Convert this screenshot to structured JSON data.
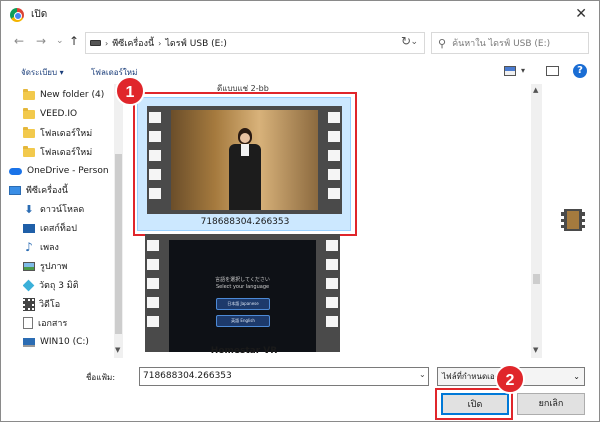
{
  "window": {
    "title": "เปิด",
    "close": "✕"
  },
  "nav": {
    "back": "←",
    "forward": "→",
    "recent": "⌄",
    "up": "↑",
    "breadcrumb": [
      "พีซีเครื่องนี้",
      "ไดรฟ์ USB (E:)"
    ],
    "refresh": "↻",
    "search_placeholder": "ค้นหาใน ไดรฟ์ USB (E:)"
  },
  "toolbar": {
    "organize": "จัดระเบียบ ▾",
    "new_folder": "โฟลเดอร์ใหม่",
    "help": "?"
  },
  "sidebar": {
    "items": [
      {
        "label": "New folder (4)",
        "icon": "folder-icon"
      },
      {
        "label": "VEED.IO",
        "icon": "folder-icon"
      },
      {
        "label": "โฟลเดอร์ใหม่",
        "icon": "folder-icon"
      },
      {
        "label": "โฟลเดอร์ใหม่",
        "icon": "folder-icon"
      },
      {
        "label": "OneDrive - Person",
        "icon": "onedrive-icon"
      },
      {
        "label": "พีซีเครื่องนี้",
        "icon": "this-pc-icon"
      },
      {
        "label": "ดาวน์โหลด",
        "icon": "downloads-icon"
      },
      {
        "label": "เดสก์ท็อป",
        "icon": "desktop-icon"
      },
      {
        "label": "เพลง",
        "icon": "music-icon"
      },
      {
        "label": "รูปภาพ",
        "icon": "pictures-icon"
      },
      {
        "label": "วัตถุ 3 มิติ",
        "icon": "3d-objects-icon"
      },
      {
        "label": "วิดีโอ",
        "icon": "videos-icon"
      },
      {
        "label": "เอกสาร",
        "icon": "documents-icon"
      },
      {
        "label": "WIN10 (C:)",
        "icon": "drive-c-icon"
      }
    ]
  },
  "files": {
    "top_label": "ดีแบบแช่ 2-bb",
    "items": [
      {
        "name": "718688304.266353",
        "selected": true
      },
      {
        "name": "Homestar VR",
        "selected": false,
        "thumb_line1": "言語を選択してください",
        "thumb_line2": "Select your language",
        "thumb_btn1": "日本語 Japanese",
        "thumb_btn2": "英語 English"
      }
    ]
  },
  "bottom": {
    "filename_label": "ชื่อแฟ้ม:",
    "filename_value": "718688304.266353",
    "filetype_value": "ไฟล์ที่กำหนดเอง",
    "open_button": "เปิด",
    "cancel_button": "ยกเลิก"
  },
  "annotations": {
    "step1": "1",
    "step2": "2",
    "color": "#e0262b"
  }
}
